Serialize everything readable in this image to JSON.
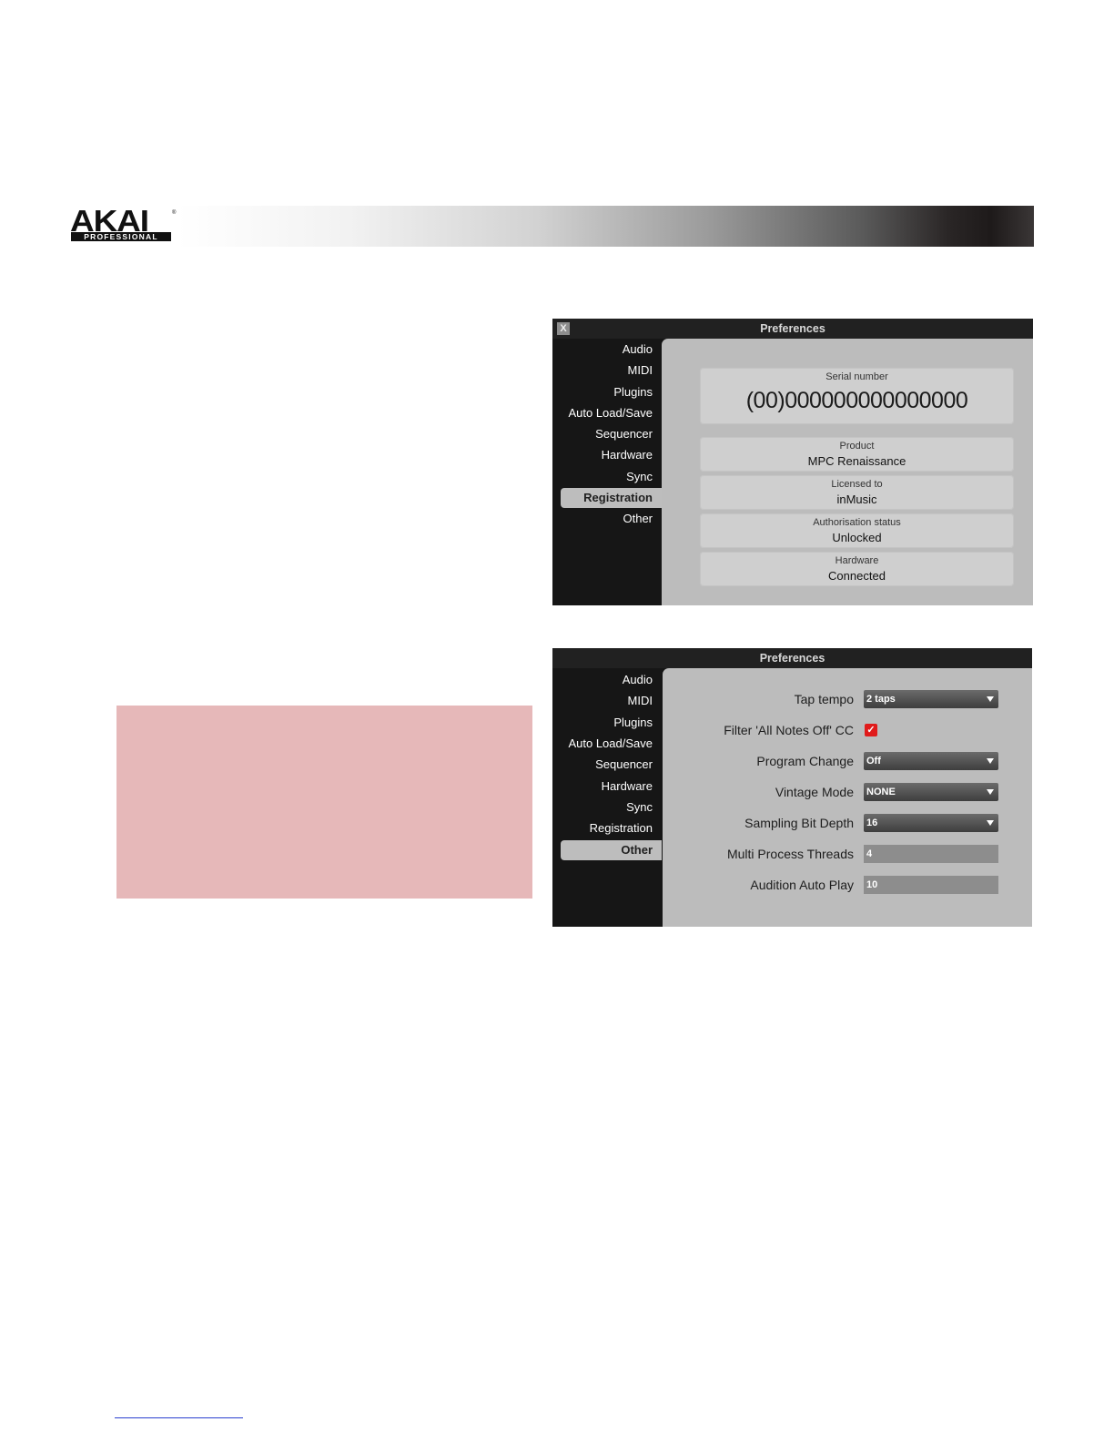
{
  "brand": {
    "logo_word": "AKAI",
    "logo_registered": "®",
    "logo_sub": "PROFESSIONAL"
  },
  "registration_window": {
    "title": "Preferences",
    "close_label": "X",
    "sidebar": [
      "Audio",
      "MIDI",
      "Plugins",
      "Auto Load/Save",
      "Sequencer",
      "Hardware",
      "Sync",
      "Registration",
      "Other"
    ],
    "active_item": "Registration",
    "serial": {
      "label": "Serial number",
      "value": "(00)000000000000000"
    },
    "fields": [
      {
        "label": "Product",
        "value": "MPC Renaissance"
      },
      {
        "label": "Licensed to",
        "value": "inMusic"
      },
      {
        "label": "Authorisation status",
        "value": "Unlocked"
      },
      {
        "label": "Hardware",
        "value": "Connected"
      }
    ]
  },
  "other_window": {
    "title": "Preferences",
    "sidebar": [
      "Audio",
      "MIDI",
      "Plugins",
      "Auto Load/Save",
      "Sequencer",
      "Hardware",
      "Sync",
      "Registration",
      "Other"
    ],
    "active_item": "Other",
    "settings": [
      {
        "label": "Tap tempo",
        "type": "dropdown",
        "value": "2 taps"
      },
      {
        "label": "Filter 'All Notes Off' CC",
        "type": "checkbox",
        "value": "✓",
        "checked": true
      },
      {
        "label": "Program Change",
        "type": "dropdown",
        "value": "Off"
      },
      {
        "label": "Vintage Mode",
        "type": "dropdown",
        "value": "NONE"
      },
      {
        "label": "Sampling Bit Depth",
        "type": "dropdown",
        "value": "16"
      },
      {
        "label": "Multi Process Threads",
        "type": "text",
        "value": "4"
      },
      {
        "label": "Audition Auto Play",
        "type": "text",
        "value": "10"
      }
    ]
  },
  "colors": {
    "note_box": "#e6b8b9",
    "window_dark": "#161616",
    "content_gray": "#bcbcbc",
    "checkbox_red": "#e01b1b"
  }
}
